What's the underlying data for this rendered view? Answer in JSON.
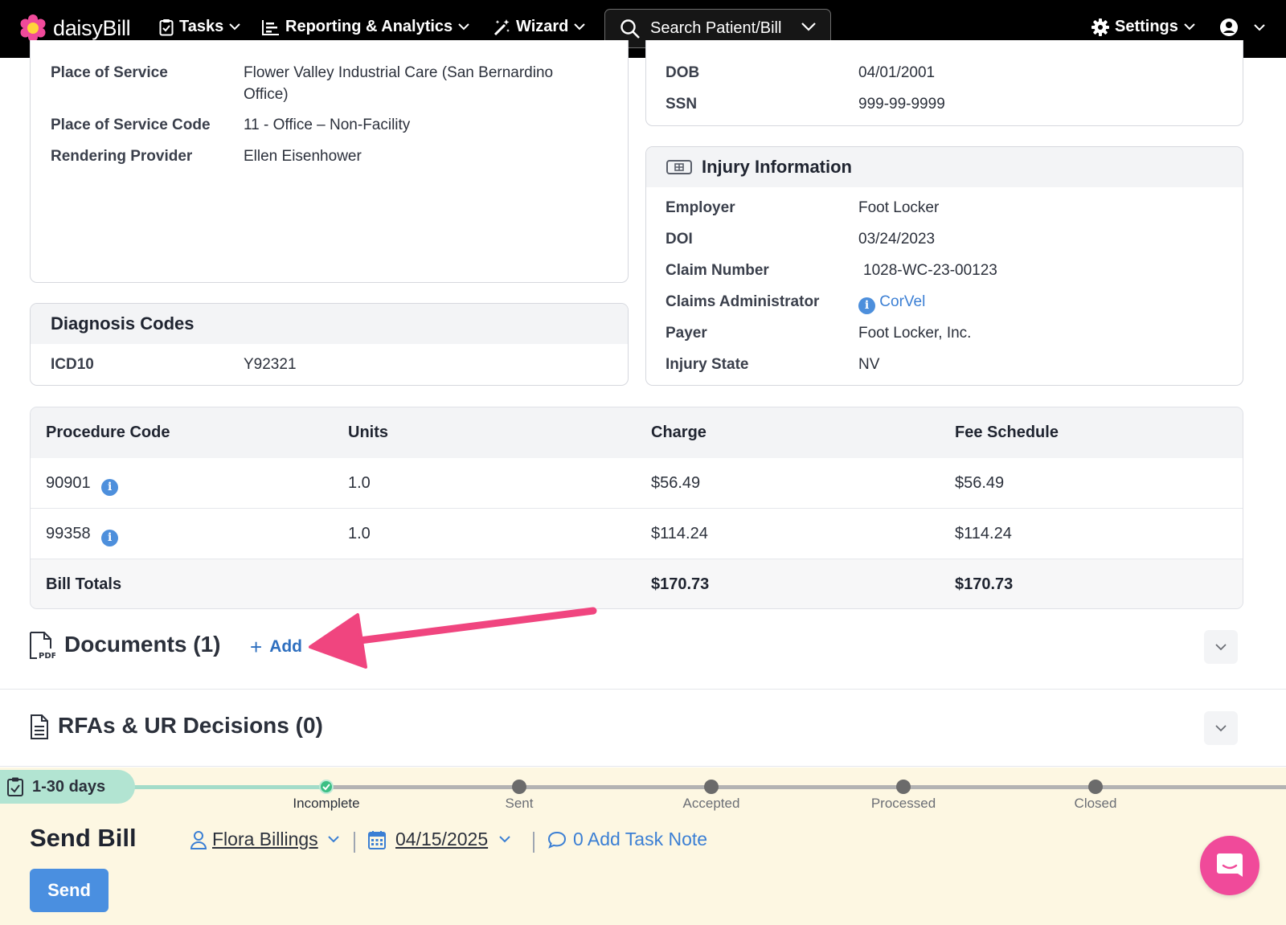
{
  "navbar": {
    "logo_text": "daisyBill",
    "tasks_label": "Tasks",
    "reporting_label": "Reporting & Analytics",
    "wizard_label": "Wizard",
    "search_label": "Search Patient/Bill",
    "settings_label": "Settings"
  },
  "bill_info": {
    "place_of_service_label": "Place of Service",
    "place_of_service_line1": "Flower Valley Industrial Care (San Bernardino",
    "place_of_service_line2": "Office)",
    "pos_code_label": "Place of Service Code",
    "pos_code_value": "11 - Office – Non-Facility",
    "rendering_provider_label": "Rendering Provider",
    "rendering_provider_value": "Ellen Eisenhower"
  },
  "patient": {
    "dob_label": "DOB",
    "dob_value": "04/01/2001",
    "ssn_label": "SSN",
    "ssn_value": "999-99-9999"
  },
  "injury": {
    "title": "Injury Information",
    "employer_label": "Employer",
    "employer_value": "Foot Locker",
    "doi_label": "DOI",
    "doi_value": "03/24/2023",
    "claim_number_label": "Claim Number",
    "claim_number_value": "1028-WC-23-00123",
    "claims_admin_label": "Claims Administrator",
    "claims_admin_value": "CorVel",
    "payer_label": "Payer",
    "payer_value": "Foot Locker, Inc.",
    "injury_state_label": "Injury State",
    "injury_state_value": "NV"
  },
  "diagnosis": {
    "title": "Diagnosis Codes",
    "code_type": "ICD10",
    "code_value": "Y92321"
  },
  "procedures": {
    "headers": [
      "Procedure Code",
      "Units",
      "Charge",
      "Fee Schedule"
    ],
    "rows": [
      {
        "code": "90901",
        "units": "1.0",
        "charge": "$56.49",
        "fee": "$56.49"
      },
      {
        "code": "99358",
        "units": "1.0",
        "charge": "$114.24",
        "fee": "$114.24"
      }
    ],
    "totals_label": "Bill Totals",
    "totals_charge": "$170.73",
    "totals_fee": "$170.73"
  },
  "documents": {
    "title": "Documents (1)",
    "add_label": "Add",
    "pdf_badge": "PDF"
  },
  "rfas": {
    "title": "RFAs & UR Decisions (0)"
  },
  "workflow": {
    "age_label": "1-30 days",
    "steps": [
      "Incomplete",
      "Sent",
      "Accepted",
      "Processed",
      "Closed"
    ],
    "task_title": "Send Bill",
    "assignee": "Flora Billings",
    "due_date": "04/15/2025",
    "task_note": "0 Add Task Note",
    "send_label": "Send"
  },
  "colors": {
    "accent": "#4a8fe0",
    "arrow": "#f0457f",
    "chat": "#f04a9a",
    "workflow_bg": "#fdf7e2",
    "age_pill": "#b2e4d2"
  }
}
